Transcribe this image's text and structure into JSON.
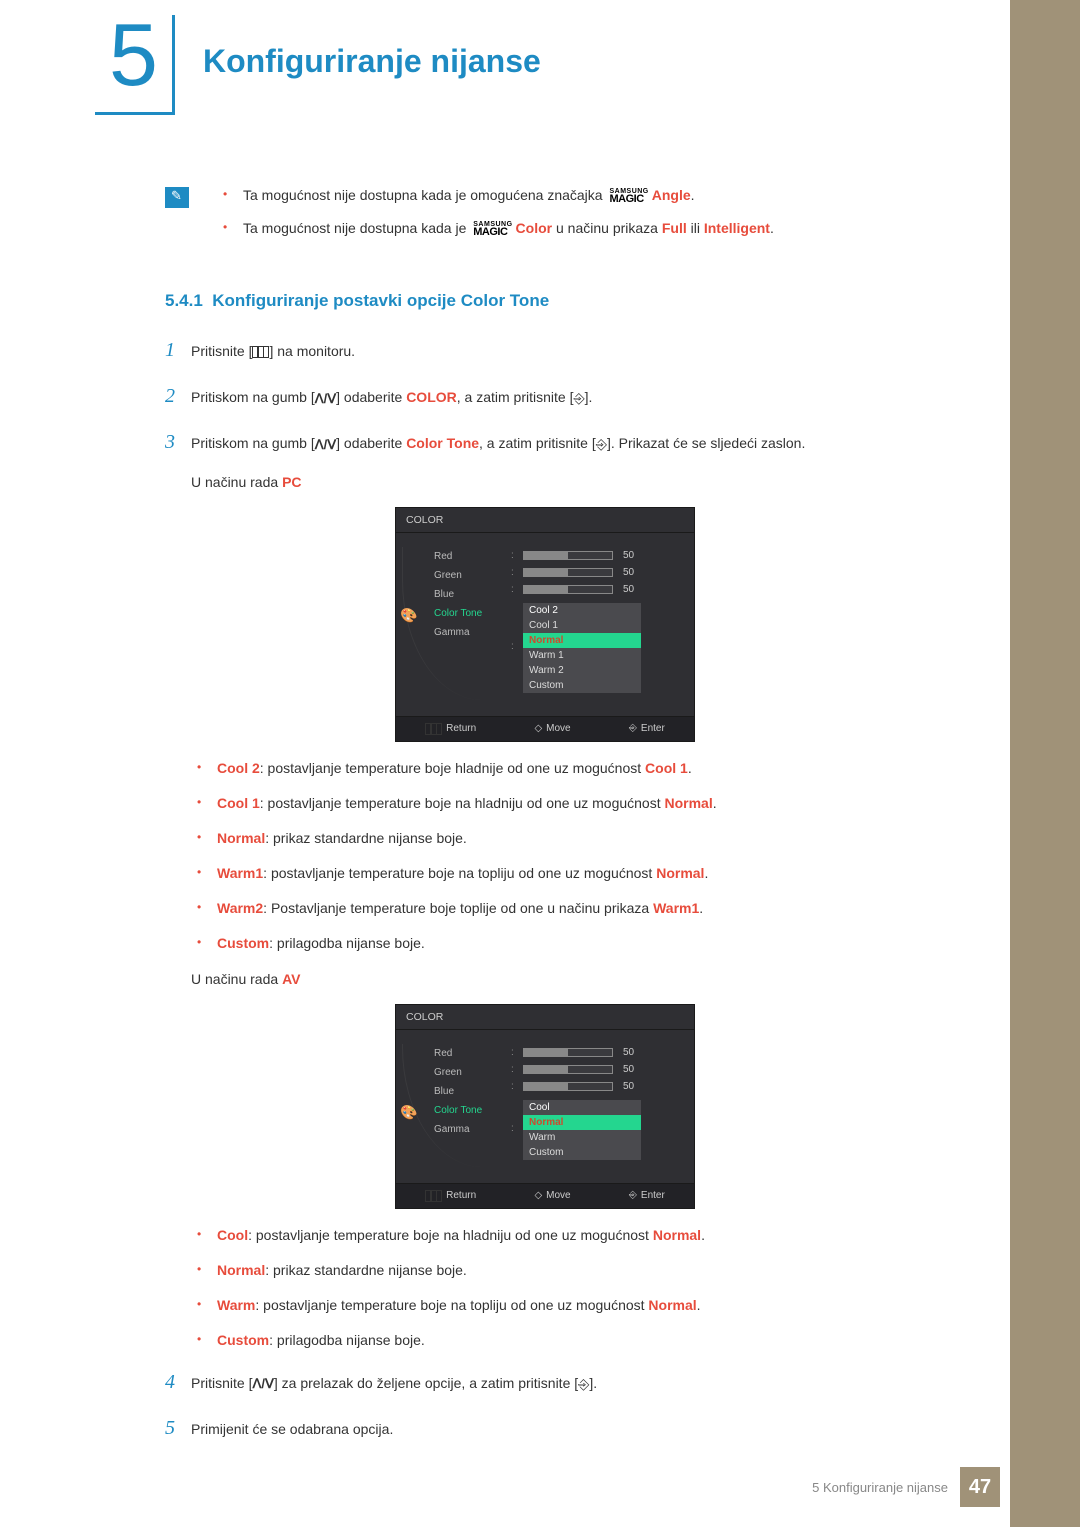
{
  "chapter_number": "5",
  "chapter_title": "Konfiguriranje nijanse",
  "notes": {
    "bullet1_pre": "Ta mogućnost nije dostupna kada je omogućena značajka ",
    "bullet1_brand_top": "SAMSUNG",
    "bullet1_brand_bottom": "MAGIC",
    "bullet1_brand_label": "Angle",
    "bullet1_post": ".",
    "bullet2_pre": "Ta mogućnost nije dostupna kada je ",
    "bullet2_brand_top": "SAMSUNG",
    "bullet2_brand_bottom": "MAGIC",
    "bullet2_brand_label": "Color",
    "bullet2_mid": " u načinu prikaza ",
    "bullet2_full": "Full",
    "bullet2_or": " ili ",
    "bullet2_intel": "Intelligent",
    "bullet2_post": "."
  },
  "subsection_number": "5.4.1",
  "subsection_title": "Konfiguriranje postavki opcije Color Tone",
  "steps": {
    "s1": "Pritisnite [",
    "s1_post": "] na monitoru.",
    "s2_pre": "Pritiskom na gumb [",
    "s2_mid": "] odaberite ",
    "s2_color": "COLOR",
    "s2_mid2": ", a zatim pritisnite [",
    "s2_post": "].",
    "s3_pre": "Pritiskom na gumb [",
    "s3_mid": "] odaberite ",
    "s3_ct": "Color Tone",
    "s3_mid2": ", a zatim pritisnite [",
    "s3_post": "]. Prikazat će se sljedeći zaslon.",
    "s3_sub_pre": "U načinu rada ",
    "s3_sub_pc": "PC",
    "s4_pre": "Pritisnite [",
    "s4_mid": "] za prelazak do željene opcije, a zatim pritisnite [",
    "s4_post": "].",
    "s5": "Primijenit će se odabrana opcija."
  },
  "osd_common": {
    "title": "COLOR",
    "labels": {
      "red": "Red",
      "green": "Green",
      "blue": "Blue",
      "color_tone": "Color Tone",
      "gamma": "Gamma"
    },
    "val50": "50",
    "footer": {
      "return": "Return",
      "move": "Move",
      "enter": "Enter"
    }
  },
  "osd_pc": {
    "options": [
      "Cool 2",
      "Cool 1",
      "Normal",
      "Warm 1",
      "Warm 2",
      "Custom"
    ],
    "highlight_index": 2
  },
  "osd_av": {
    "options": [
      "Cool",
      "Normal",
      "Warm",
      "Custom"
    ],
    "highlight_index": 1
  },
  "desc_pc": [
    {
      "label": "Cool 2",
      "text": ": postavljanje temperature boje hladnije od one uz mogućnost ",
      "ref": "Cool 1",
      "post": "."
    },
    {
      "label": "Cool 1",
      "text": ": postavljanje temperature boje na hladniju od one uz mogućnost ",
      "ref": "Normal",
      "post": "."
    },
    {
      "label": "Normal",
      "text": ": prikaz standardne nijanse boje.",
      "ref": "",
      "post": ""
    },
    {
      "label": "Warm1",
      "text": ": postavljanje temperature boje na topliju od one uz mogućnost ",
      "ref": "Normal",
      "post": "."
    },
    {
      "label": "Warm2",
      "text": ": Postavljanje temperature boje toplije od one u načinu prikaza ",
      "ref": "Warm1",
      "post": "."
    },
    {
      "label": "Custom",
      "text": ": prilagodba nijanse boje.",
      "ref": "",
      "post": ""
    }
  ],
  "av_mode_pre": "U načinu rada ",
  "av_mode_label": "AV",
  "desc_av": [
    {
      "label": "Cool",
      "text": ": postavljanje temperature boje na hladniju od one uz mogućnost ",
      "ref": "Normal",
      "post": "."
    },
    {
      "label": "Normal",
      "text": ": prikaz standardne nijanse boje.",
      "ref": "",
      "post": ""
    },
    {
      "label": "Warm",
      "text": ": postavljanje temperature boje na topliju od one uz mogućnost ",
      "ref": "Normal",
      "post": "."
    },
    {
      "label": "Custom",
      "text": ": prilagodba nijanse boje.",
      "ref": "",
      "post": ""
    }
  ],
  "footer": {
    "text": "5 Konfiguriranje nijanse",
    "page": "47"
  }
}
